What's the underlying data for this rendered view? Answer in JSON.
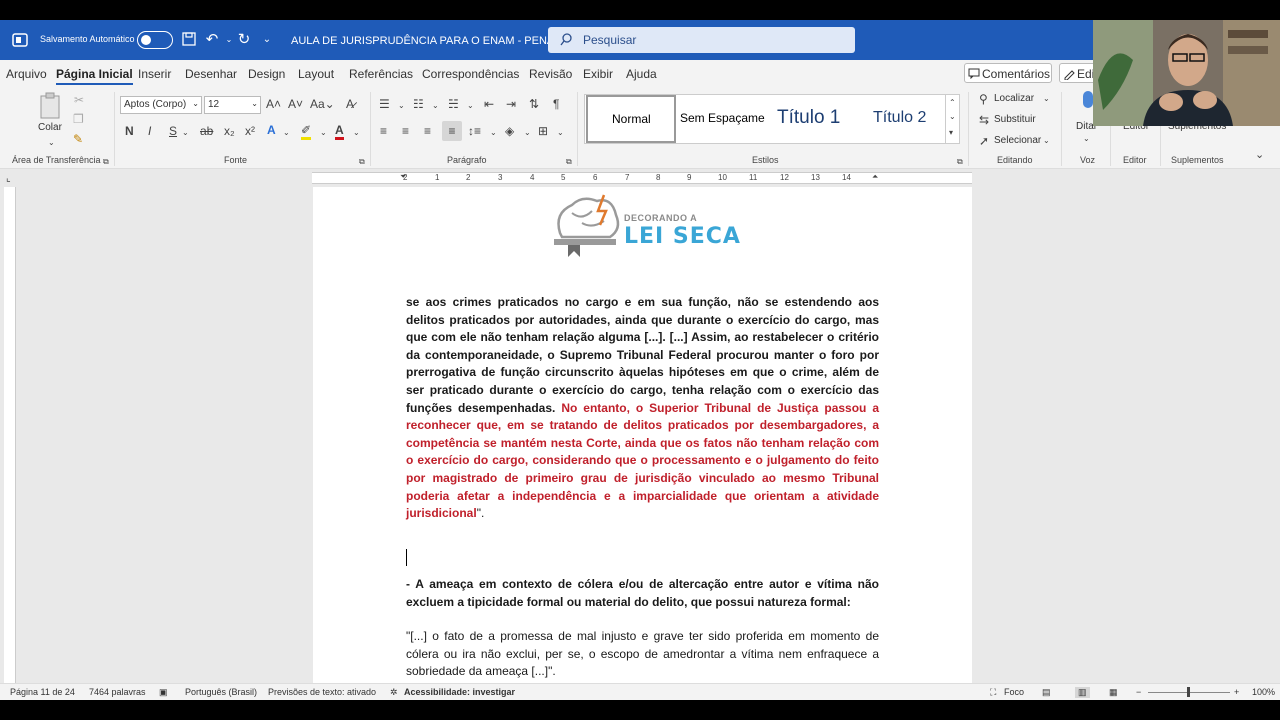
{
  "titlebar": {
    "autosave_label": "Salvamento Automático",
    "doc_title": "AULA DE JURISPRUDÊNCIA PARA O ENAM - PENAL",
    "search_placeholder": "Pesquisar",
    "brand_color": "#1f5bb8"
  },
  "menu": {
    "tabs": [
      "Arquivo",
      "Página Inicial",
      "Inserir",
      "Desenhar",
      "Design",
      "Layout",
      "Referências",
      "Correspondências",
      "Revisão",
      "Exibir",
      "Ajuda"
    ],
    "active_tab": "Página Inicial",
    "comments_label": "Comentários",
    "edit_label": "Edi"
  },
  "ribbon": {
    "clipboard": {
      "paste_label": "Colar",
      "group_label": "Área de Transferência"
    },
    "font": {
      "font_name": "Aptos (Corpo)",
      "font_size": "12",
      "group_label": "Fonte",
      "bold": "N",
      "italic": "I",
      "underline": "S"
    },
    "paragraph": {
      "group_label": "Parágrafo"
    },
    "styles": {
      "items": [
        "Normal",
        "Sem Espaçame",
        "Título 1",
        "Título 2"
      ],
      "group_label": "Estilos"
    },
    "editing": {
      "find": "Localizar",
      "replace": "Substituir",
      "select": "Selecionar",
      "group_label": "Editando"
    },
    "voice": {
      "dictate": "Ditar",
      "group_label": "Voz"
    },
    "editor": {
      "label": "Editor",
      "group_label": "Editor"
    },
    "addins": {
      "label": "Suplementos",
      "group_label": "Suplementos"
    }
  },
  "ruler": {
    "numbers": [
      "2",
      "1",
      "1",
      "2",
      "3",
      "4",
      "5",
      "6",
      "7",
      "8",
      "9",
      "10",
      "11",
      "12",
      "13",
      "14",
      "15"
    ]
  },
  "document": {
    "logo_line1": "DECORANDO A",
    "logo_line2": "LEI SECA",
    "para1_black": "se aos crimes praticados no cargo e em sua função, não se estendendo aos delitos praticados por autoridades, ainda que durante o exercício do cargo, mas que com ele não tenham relação alguma [...]. [...] Assim, ao restabelecer o critério da contemporaneidade, o Supremo Tribunal Federal procurou manter o foro por prerrogativa de função circunscrito àquelas hipóteses em que o crime, além de ser praticado durante o exercício do cargo, tenha relação com o exercício das funções desempenhadas.",
    "para1_red": "No entanto, o Superior Tribunal de Justiça passou a reconhecer que, em se tratando de delitos praticados por desembargadores, a competência se mantém nesta Corte, ainda que os fatos não tenham relação com o exercício do cargo, considerando que o processamento e o julgamento do feito por magistrado de primeiro grau de jurisdição vinculado ao mesmo Tribunal poderia afetar a independência e a imparcialidade que orientam a atividade jurisdicional",
    "para1_end": "\".",
    "para2": "- A ameaça em contexto de cólera e/ou de altercação entre autor e vítima não excluem a tipicidade formal ou material do delito, que possui natureza formal:",
    "para3": "\"[...] o fato de a promessa de mal injusto e grave ter sido proferida em momento de cólera ou ira não exclui, per se, o escopo de amedrontar a vítima nem enfraquece a sobriedade da ameaça [...]\"."
  },
  "status": {
    "page": "Página 11 de 24",
    "words": "7464 palavras",
    "language": "Português (Brasil)",
    "predictions": "Previsões de texto: ativado",
    "accessibility": "Acessibilidade: investigar",
    "focus": "Foco",
    "zoom": "100%"
  },
  "colors": {
    "red_text": "#c0202b"
  }
}
